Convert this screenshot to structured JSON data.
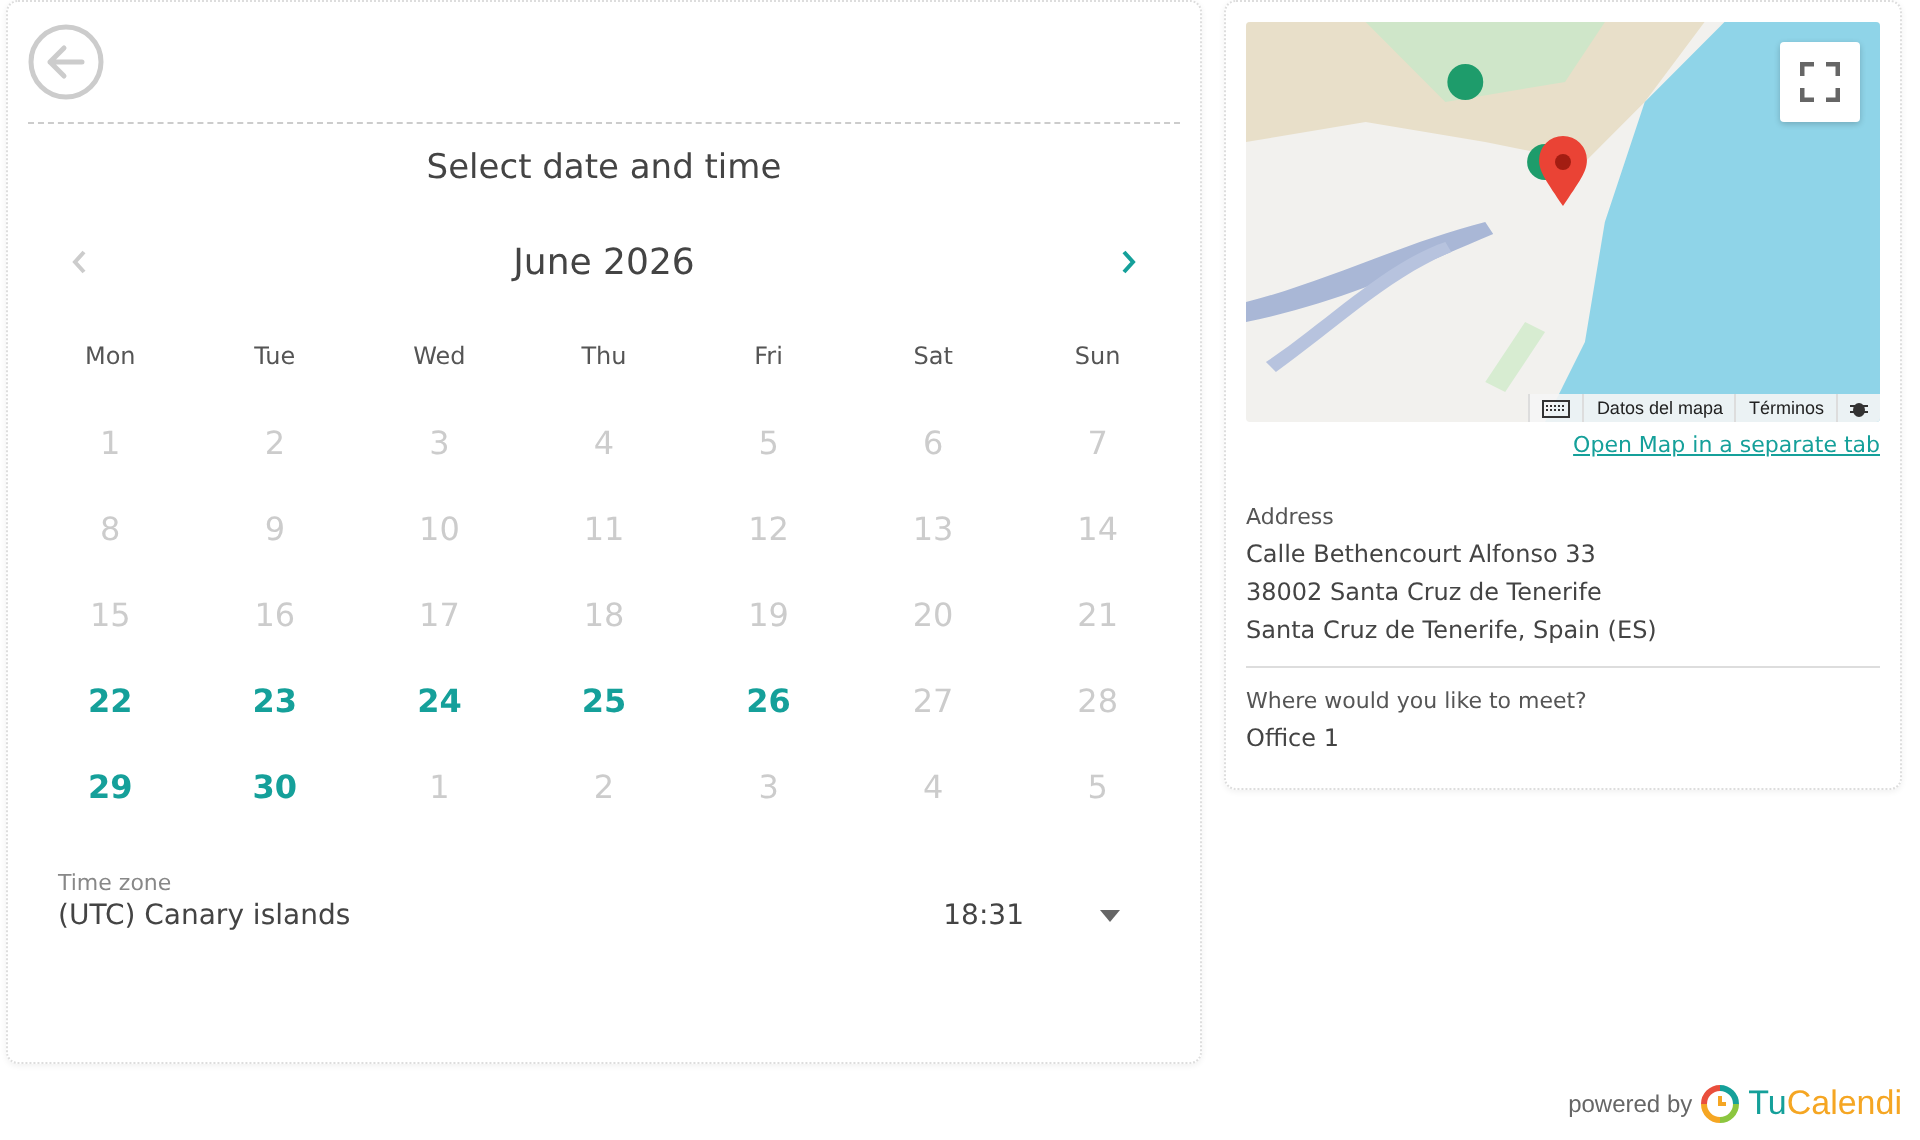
{
  "header": {
    "title": "Select date and time"
  },
  "calendar": {
    "month": "June 2026",
    "prev_enabled": false,
    "next_enabled": true,
    "weekdays": [
      "Mon",
      "Tue",
      "Wed",
      "Thu",
      "Fri",
      "Sat",
      "Sun"
    ],
    "days": [
      {
        "label": "1",
        "available": false
      },
      {
        "label": "2",
        "available": false
      },
      {
        "label": "3",
        "available": false
      },
      {
        "label": "4",
        "available": false
      },
      {
        "label": "5",
        "available": false
      },
      {
        "label": "6",
        "available": false
      },
      {
        "label": "7",
        "available": false
      },
      {
        "label": "8",
        "available": false
      },
      {
        "label": "9",
        "available": false
      },
      {
        "label": "10",
        "available": false
      },
      {
        "label": "11",
        "available": false
      },
      {
        "label": "12",
        "available": false
      },
      {
        "label": "13",
        "available": false
      },
      {
        "label": "14",
        "available": false
      },
      {
        "label": "15",
        "available": false
      },
      {
        "label": "16",
        "available": false
      },
      {
        "label": "17",
        "available": false
      },
      {
        "label": "18",
        "available": false
      },
      {
        "label": "19",
        "available": false
      },
      {
        "label": "20",
        "available": false
      },
      {
        "label": "21",
        "available": false
      },
      {
        "label": "22",
        "available": true
      },
      {
        "label": "23",
        "available": true
      },
      {
        "label": "24",
        "available": true
      },
      {
        "label": "25",
        "available": true
      },
      {
        "label": "26",
        "available": true
      },
      {
        "label": "27",
        "available": false
      },
      {
        "label": "28",
        "available": false
      },
      {
        "label": "29",
        "available": true
      },
      {
        "label": "30",
        "available": true
      },
      {
        "label": "1",
        "available": false
      },
      {
        "label": "2",
        "available": false
      },
      {
        "label": "3",
        "available": false
      },
      {
        "label": "4",
        "available": false
      },
      {
        "label": "5",
        "available": false
      }
    ]
  },
  "timezone": {
    "label": "Time zone",
    "value": "(UTC) Canary islands",
    "time": "18:31"
  },
  "map": {
    "attribution": [
      "Datos del mapa",
      "Términos"
    ],
    "link": "Open Map in a separate tab"
  },
  "address": {
    "label": "Address",
    "lines": [
      "Calle Bethencourt Alfonso 33",
      "38002 Santa Cruz de Tenerife",
      "Santa Cruz de Tenerife, Spain (ES)"
    ]
  },
  "meeting": {
    "label": "Where would you like to meet?",
    "value": "Office 1"
  },
  "footer": {
    "powered_by": "powered by",
    "logo": [
      {
        "text": "Tu",
        "color": "#15a09a"
      },
      {
        "text": "Calendi",
        "color": "#f5a623"
      }
    ]
  }
}
